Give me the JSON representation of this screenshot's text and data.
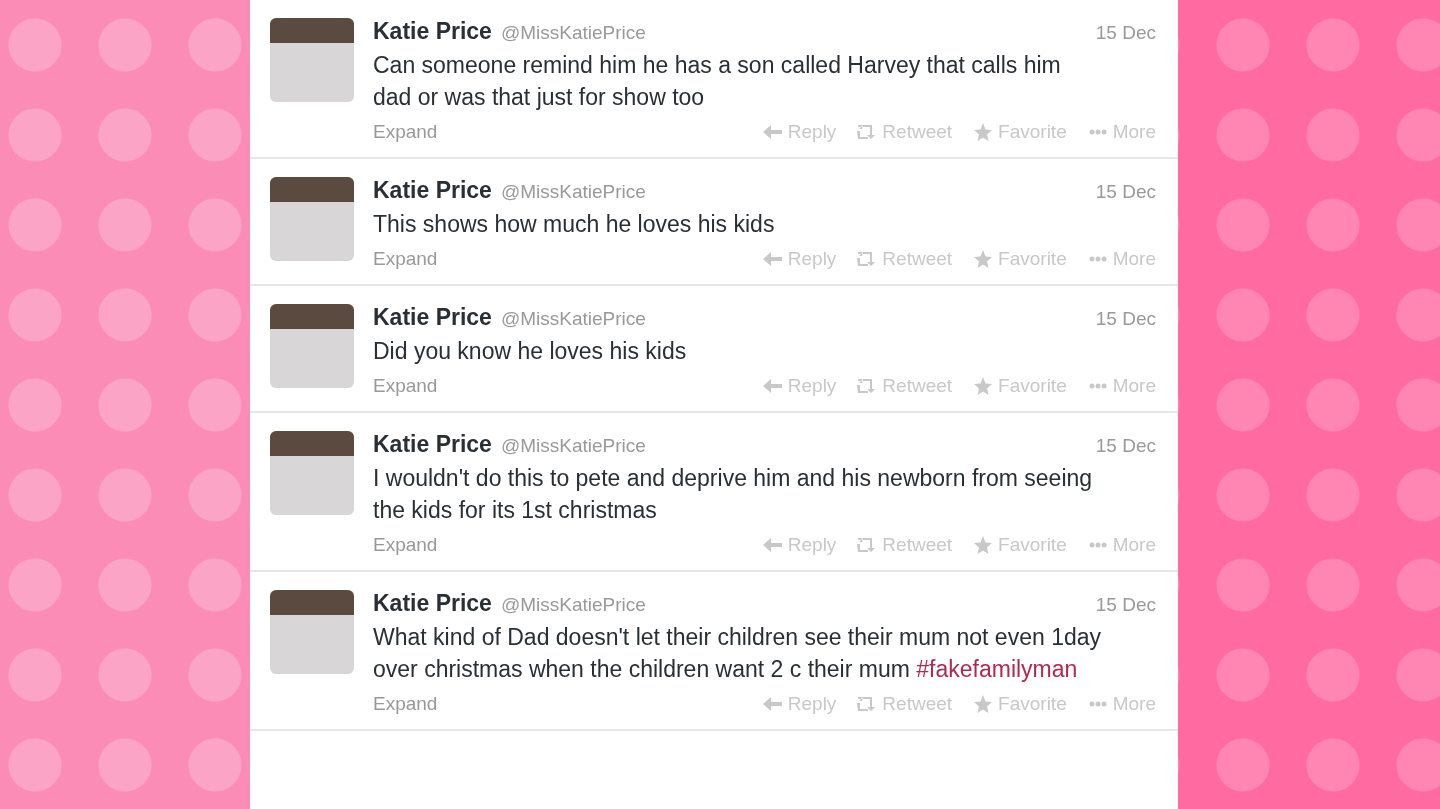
{
  "tweets": [
    {
      "name": "Katie Price",
      "handle": "@MissKatiePrice",
      "date": "15 Dec",
      "text": "Can someone remind him he has a son called Harvey that calls him dad or was that just for show too",
      "expand": "Expand",
      "actions": [
        {
          "kind": "reply",
          "label": "Reply"
        },
        {
          "kind": "retweet",
          "label": "Retweet"
        },
        {
          "kind": "favorite",
          "label": "Favorite"
        },
        {
          "kind": "more",
          "label": "More"
        }
      ]
    },
    {
      "name": "Katie Price",
      "handle": "@MissKatiePrice",
      "date": "15 Dec",
      "text": "This shows how much he loves his kids",
      "expand": "Expand",
      "actions": [
        {
          "kind": "reply",
          "label": "Reply"
        },
        {
          "kind": "retweet",
          "label": "Retweet"
        },
        {
          "kind": "favorite",
          "label": "Favorite"
        },
        {
          "kind": "more",
          "label": "More"
        }
      ]
    },
    {
      "name": "Katie Price",
      "handle": "@MissKatiePrice",
      "date": "15 Dec",
      "text": "Did you know he loves his kids",
      "expand": "Expand",
      "actions": [
        {
          "kind": "reply",
          "label": "Reply"
        },
        {
          "kind": "retweet",
          "label": "Retweet"
        },
        {
          "kind": "favorite",
          "label": "Favorite"
        },
        {
          "kind": "more",
          "label": "More"
        }
      ]
    },
    {
      "name": "Katie Price",
      "handle": "@MissKatiePrice",
      "date": "15 Dec",
      "text": "I wouldn't do this to pete and deprive him and his newborn from seeing the kids for its 1st christmas",
      "expand": "Expand",
      "actions": [
        {
          "kind": "reply",
          "label": "Reply"
        },
        {
          "kind": "retweet",
          "label": "Retweet"
        },
        {
          "kind": "favorite",
          "label": "Favorite"
        },
        {
          "kind": "more",
          "label": "More"
        }
      ]
    },
    {
      "name": "Katie Price",
      "handle": "@MissKatiePrice",
      "date": "15 Dec",
      "text": "What kind of Dad doesn't let their children see their mum not even 1day over christmas when the children want 2 c their mum",
      "hashtag": "#fakefamilyman",
      "expand": "Expand",
      "actions": [
        {
          "kind": "reply",
          "label": "Reply"
        },
        {
          "kind": "retweet",
          "label": "Retweet"
        },
        {
          "kind": "favorite",
          "label": "Favorite"
        },
        {
          "kind": "more",
          "label": "More"
        }
      ]
    }
  ]
}
